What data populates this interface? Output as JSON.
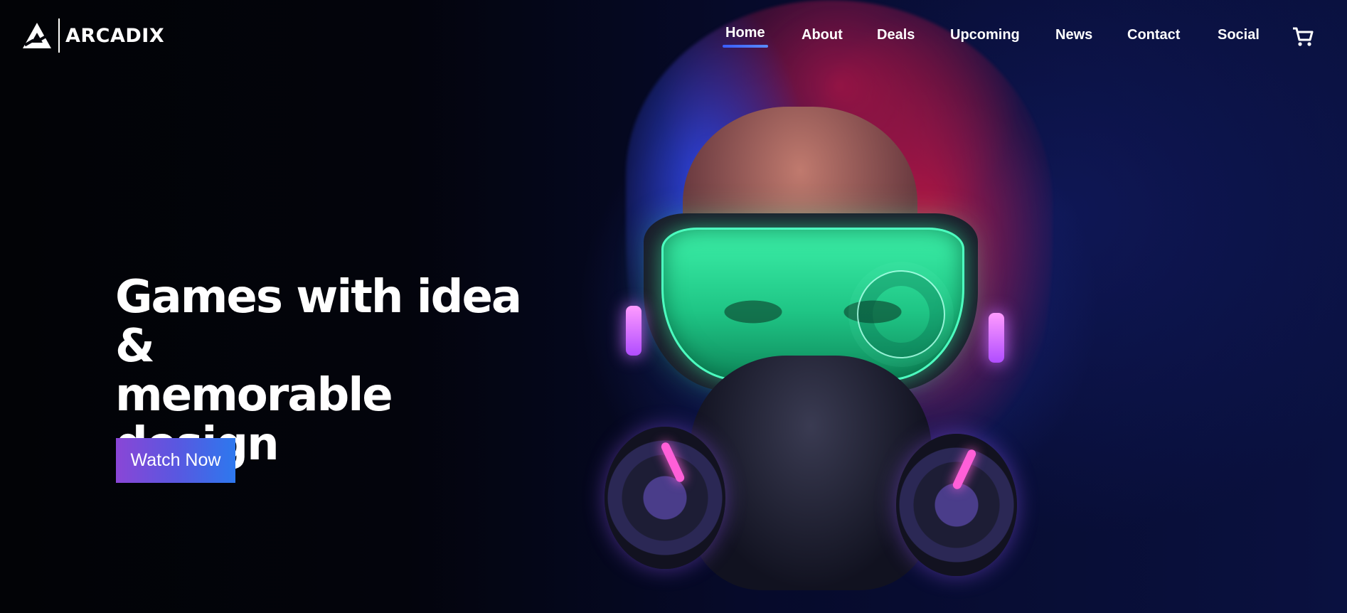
{
  "brand": {
    "name": "ARCADIX",
    "logo_icon": "arcadix-triangle-logo"
  },
  "nav": {
    "items": [
      {
        "label": "Home",
        "active": true
      },
      {
        "label": "About",
        "active": false
      },
      {
        "label": "Deals",
        "active": false
      },
      {
        "label": "Upcoming",
        "active": false
      },
      {
        "label": "News",
        "active": false
      },
      {
        "label": "Contact",
        "active": false
      },
      {
        "label": "Social",
        "active": false
      }
    ],
    "cart_icon": "shopping-cart-icon",
    "accent_color": "#3a5dff"
  },
  "hero": {
    "headline_line1": "Games with idea &",
    "headline_line2": "memorable",
    "headline_line3": "design",
    "cta_label": "Watch Now",
    "cta_gradient": [
      "#8a46d6",
      "#2d78ee"
    ]
  },
  "colors": {
    "background": "#030510",
    "text": "#ffffff",
    "lens_green": "#3cf0a8",
    "hair_red": "#c8143c",
    "hair_blue": "#3246e6"
  }
}
